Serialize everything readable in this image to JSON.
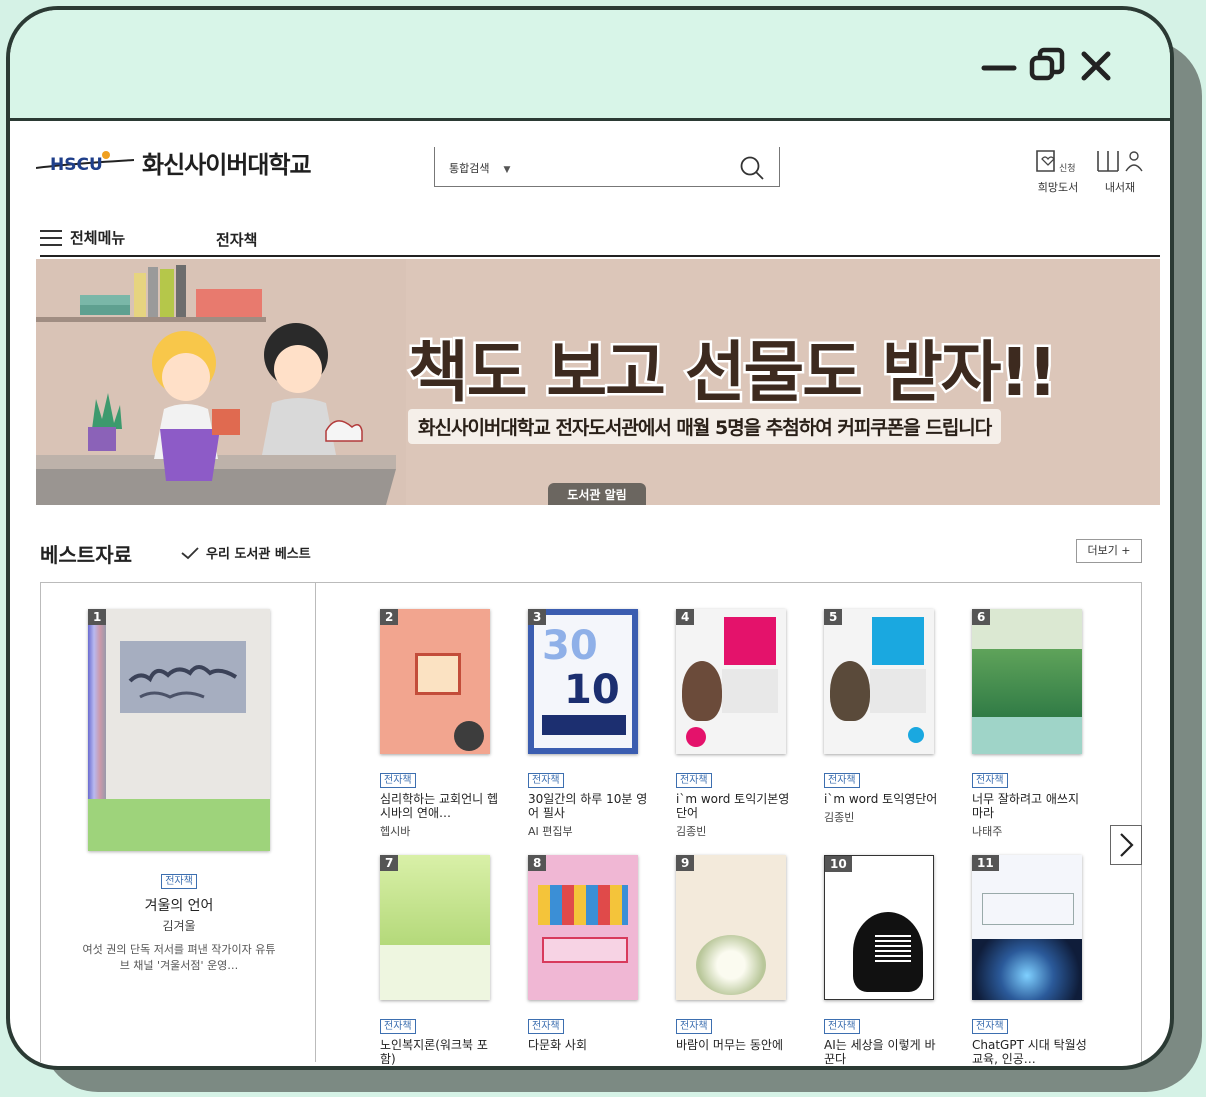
{
  "window": {
    "controls": [
      "minimize-icon",
      "restore-icon",
      "close-icon"
    ]
  },
  "header": {
    "logo_mark": "HSCU",
    "logo_text": "화신사이버대학교",
    "search": {
      "scope": "통합검색",
      "value": "",
      "placeholder": ""
    },
    "links": [
      {
        "label": "희망도서",
        "icon": "request-book-icon",
        "icon_text": "신청"
      },
      {
        "label": "내서재",
        "icon": "my-library-icon"
      }
    ]
  },
  "nav": {
    "menu_label": "전체메뉴",
    "items": [
      "전자책"
    ]
  },
  "banner": {
    "title": "책도 보고 선물도 받자!!",
    "subtitle": "화신사이버대학교 전자도서관에서 매월 5명을 추첨하여 커피쿠폰을 드립니다",
    "tab_label": "도서관 알림",
    "colors": {
      "background": "#dcc6b9",
      "title": "#3d2a1f"
    }
  },
  "best": {
    "title": "베스트자료",
    "subtitle": "우리 도서관 베스트",
    "more_label": "더보기 +",
    "featured": {
      "rank": "1",
      "tag": "전자책",
      "title": "겨울의 언어",
      "author": "김겨울",
      "description": "여섯 권의 단독 저서를 펴낸 작가이자 유튜브 채널 '겨울서점' 운영…"
    },
    "books": [
      {
        "rank": "2",
        "tag": "전자책",
        "title": "심리학하는 교회언니 헵시바의 연애…",
        "author": "헵시바",
        "cover": "#f2a58f"
      },
      {
        "rank": "3",
        "tag": "전자책",
        "title": "30일간의 하루 10분 영어 필사",
        "author": "AI 편집부",
        "cover": "#3b5db0"
      },
      {
        "rank": "4",
        "tag": "전자책",
        "title": "i`m word 토익기본영단어",
        "author": "김종빈",
        "cover": "#f4f4f4"
      },
      {
        "rank": "5",
        "tag": "전자책",
        "title": "i`m word 토익영단어",
        "author": "김종빈",
        "cover": "#f4f4f4"
      },
      {
        "rank": "6",
        "tag": "전자책",
        "title": "너무 잘하려고 애쓰지 마라",
        "author": "나태주",
        "cover": "#dbe8d2"
      },
      {
        "rank": "7",
        "tag": "전자책",
        "title": "노인복지론(워크북 포함)",
        "author": "",
        "cover": "#c9e49a"
      },
      {
        "rank": "8",
        "tag": "전자책",
        "title": "다문화 사회",
        "author": "",
        "cover": "#f0b7d4"
      },
      {
        "rank": "9",
        "tag": "전자책",
        "title": "바람이 머무는 동안에",
        "author": "",
        "cover": "#f3eadb"
      },
      {
        "rank": "10",
        "tag": "전자책",
        "title": "AI는 세상을 이렇게 바꾼다",
        "author": "",
        "cover": "#ffffff"
      },
      {
        "rank": "11",
        "tag": "전자책",
        "title": "ChatGPT 시대 탁월성 교육, 인공…",
        "author": "",
        "cover": "#f4f6fb"
      }
    ]
  }
}
